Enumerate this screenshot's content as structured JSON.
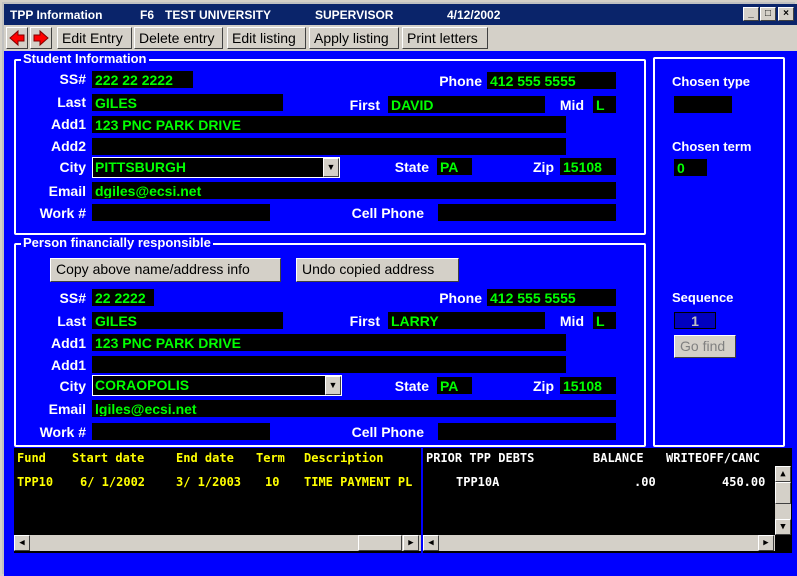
{
  "titlebar": {
    "app_title": "TPP Information",
    "fkey": "F6",
    "school": "TEST UNIVERSITY",
    "role": "SUPERVISOR",
    "date": "4/12/2002",
    "minimize": "_",
    "maximize": "□",
    "close": "×"
  },
  "toolbar": {
    "edit_entry": "Edit Entry",
    "delete_entry": "Delete entry",
    "edit_listing": "Edit listing",
    "apply_listing": "Apply listing",
    "print_letters": "Print letters"
  },
  "student": {
    "group_label": "Student Information",
    "labels": {
      "ss": "SS#",
      "phone": "Phone",
      "last": "Last",
      "first": "First",
      "mid": "Mid",
      "add1": "Add1",
      "add2": "Add2",
      "city": "City",
      "state": "State",
      "zip": "Zip",
      "email": "Email",
      "work": "Work #",
      "cell": "Cell Phone"
    },
    "ss": "222 22 2222",
    "phone": "412 555 5555",
    "last": "GILES",
    "first": "DAVID",
    "mid": "L",
    "add1": "123 PNC PARK DRIVE",
    "add2": "",
    "city": "PITTSBURGH",
    "state": "PA",
    "zip": "15108",
    "email": "dgiles@ecsi.net",
    "work": "",
    "cell": ""
  },
  "responsible": {
    "group_label": "Person financially responsible",
    "copy_button": "Copy above name/address info",
    "undo_button": "Undo copied address",
    "labels": {
      "ss": "SS#",
      "phone": "Phone",
      "last": "Last",
      "first": "First",
      "mid": "Mid",
      "add1": "Add1",
      "add2": "Add1",
      "city": "City",
      "state": "State",
      "zip": "Zip",
      "email": "Email",
      "work": "Work #",
      "cell": "Cell Phone"
    },
    "ss": "22 2222",
    "phone": "412 555 5555",
    "last": "GILES",
    "first": "LARRY",
    "mid": "L",
    "add1": "123 PNC PARK DRIVE",
    "add2": "",
    "city": "CORAOPOLIS",
    "state": "PA",
    "zip": "15108",
    "email": "lgiles@ecsi.net",
    "work": "",
    "cell": ""
  },
  "side": {
    "chosen_type_label": "Chosen type",
    "chosen_type": "",
    "chosen_term_label": "Chosen term",
    "chosen_term": "0",
    "sequence_label": "Sequence",
    "sequence": "1",
    "go_find": "Go find"
  },
  "left_grid": {
    "headers": [
      "Fund",
      "Start date",
      "End date",
      "Term",
      "Description"
    ],
    "rows": [
      [
        "TPP10",
        "6/ 1/2002",
        "3/ 1/2003",
        "10",
        "TIME PAYMENT PL"
      ]
    ]
  },
  "right_grid": {
    "headers": [
      "PRIOR TPP DEBTS",
      "BALANCE",
      "WRITEOFF/CANC"
    ],
    "rows": [
      [
        "TPP10A",
        ".00",
        "450.00"
      ]
    ]
  },
  "colors": {
    "client_bg": "#0000ff",
    "field_bg": "#000000",
    "field_text": "#00ff00",
    "grid_text": "#ffff00"
  }
}
